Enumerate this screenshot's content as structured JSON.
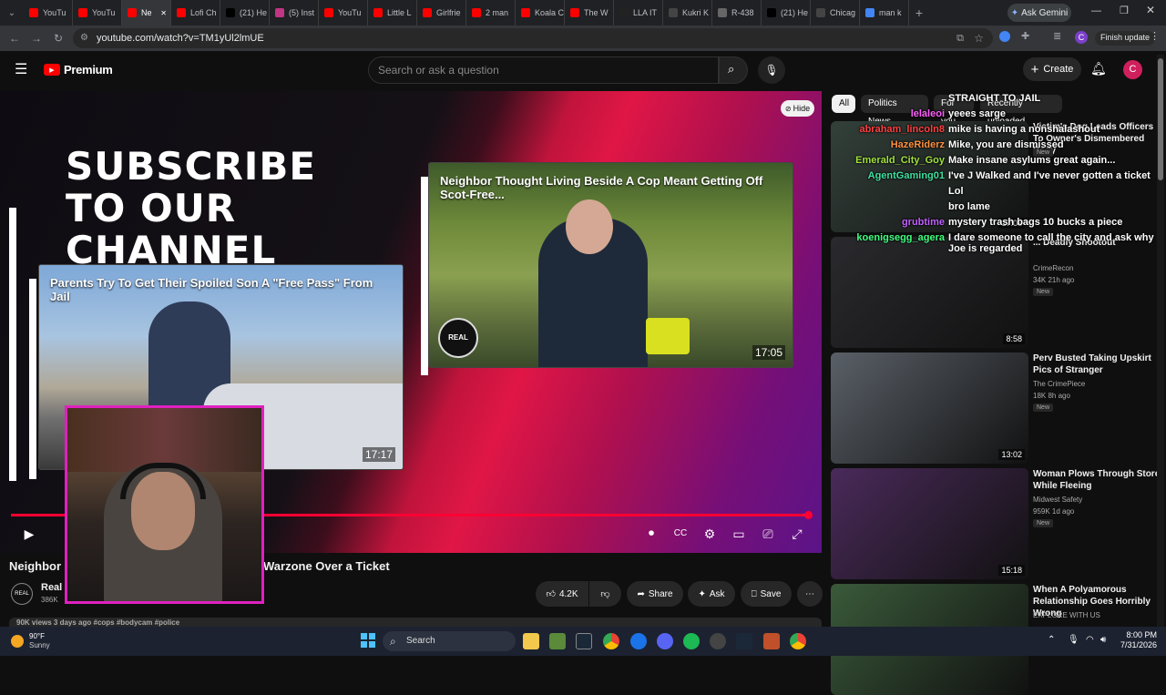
{
  "browser": {
    "tabs": [
      {
        "label": "YouTu",
        "color": "#ff0000"
      },
      {
        "label": "YouTu",
        "color": "#ff0000"
      },
      {
        "label": "Ne",
        "color": "#ff0000",
        "active": true
      },
      {
        "label": "Lofi Ch",
        "color": "#ff0000"
      },
      {
        "label": "(21) He",
        "color": "#000000"
      },
      {
        "label": "(5) Inst",
        "color": "#c13584"
      },
      {
        "label": "YouTu",
        "color": "#ff0000"
      },
      {
        "label": "Little L",
        "color": "#ff0000"
      },
      {
        "label": "Girlfrie",
        "color": "#ff0000"
      },
      {
        "label": "2 man",
        "color": "#ff0000"
      },
      {
        "label": "Koala C",
        "color": "#ff0000"
      },
      {
        "label": "The W",
        "color": "#ff0000"
      },
      {
        "label": "LLA IT",
        "color": "#222222"
      },
      {
        "label": "Kukri K",
        "color": "#444444"
      },
      {
        "label": "R-438",
        "color": "#666666"
      },
      {
        "label": "(21) He",
        "color": "#000000"
      },
      {
        "label": "Chicag",
        "color": "#444444"
      },
      {
        "label": "man k",
        "color": "#4285f4"
      }
    ],
    "new_tab": "+",
    "ask_gemini": "Ask Gemini",
    "url": "youtube.com/watch?v=TM1yUl2lmUE",
    "finish_update": "Finish update",
    "profile_letter": "C"
  },
  "youtube": {
    "logo_label": "Premium",
    "search_placeholder": "Search or ask a question",
    "create_label": "Create",
    "avatar_letter": "C"
  },
  "player": {
    "subscribe_text": "SUBSCRIBE TO OUR CHANNEL",
    "hide_label": "Hide",
    "card_left": {
      "title": "Parents Try To Get Their Spoiled Son A \"Free Pass\" From Jail",
      "duration": "17:17"
    },
    "card_right": {
      "title": "Neighbor Thought Living Beside A Cop Meant Getting Off Scot-Free...",
      "duration": "17:05"
    },
    "progress": 0.99
  },
  "video": {
    "title_left": "Neighbor",
    "title_right": "Warzone Over a Ticket",
    "channel": "Real",
    "subs": "386K",
    "likes": "4.2K",
    "share": "Share",
    "ask": "Ask",
    "save": "Save",
    "meta": "90K views  3 days ago  #cops #bodycam #police"
  },
  "sidebar": {
    "chips": [
      "All",
      "Politics News",
      "For you",
      "Recently uploaded"
    ],
    "items": [
      {
        "title": "Victim's Dog Leads Officers To Owner's Dismembered Body",
        "channel": "",
        "meta": "",
        "new": "New",
        "duration": "17:06",
        "thumb": "#33403a"
      },
      {
        "title": "... Deadly Shootout",
        "channel": "CrimeRecon",
        "meta": "34K  21h ago",
        "new": "New",
        "duration": "8:58",
        "thumb": "#2a2a2e"
      },
      {
        "title": "Perv Busted Taking Upskirt Pics of Stranger",
        "channel": "The CrimePiece",
        "meta": "18K  8h ago",
        "new": "New",
        "duration": "13:02",
        "thumb": "#5a6068"
      },
      {
        "title": "Woman Plows Through Store While Fleeing",
        "channel": "Midwest Safety",
        "meta": "959K  1d ago",
        "new": "New",
        "duration": "15:18",
        "thumb": "#4a2a5a"
      },
      {
        "title": "When A Polyamorous Relationship Goes Horribly Wrong",
        "channel": "EXPLORE WITH US",
        "meta": "",
        "new": "",
        "duration": "",
        "thumb": "#3a5a3a"
      }
    ]
  },
  "chat": [
    {
      "user": "",
      "msg": "STRAIGHT TO JAIL",
      "color": "#ffffff"
    },
    {
      "user": "lelaleoi",
      "msg": "yeees sarge",
      "color": "#ff60ff"
    },
    {
      "user": "abraham_lincoln8",
      "msg": "mike is having a nonshalashout",
      "color": "#ff4040"
    },
    {
      "user": "HazeRiderz",
      "msg": "Mike, you are dismissed",
      "color": "#ff9040"
    },
    {
      "user": "Emerald_City_Goy",
      "msg": "Make insane asylums great again...",
      "color": "#a0e040"
    },
    {
      "user": "AgentGaming01",
      "msg": "I've J Walked and I've never gotten a ticket",
      "color": "#40e0a0"
    },
    {
      "user": "",
      "msg": "Lol",
      "color": "#4080ff"
    },
    {
      "user": "",
      "msg": "bro lame",
      "color": "#40c040"
    },
    {
      "user": "grubtime",
      "msg": "mystery trash bags 10 bucks a piece",
      "color": "#c060ff"
    },
    {
      "user": "koenigsegg_agera",
      "msg": "I dare someone to call the city and ask why Joe is regarded",
      "color": "#40ff80"
    }
  ],
  "taskbar": {
    "weather_temp": "90°F",
    "weather_desc": "Sunny",
    "search": "Search",
    "time": "8:00 PM",
    "date": "7/31/2026"
  }
}
